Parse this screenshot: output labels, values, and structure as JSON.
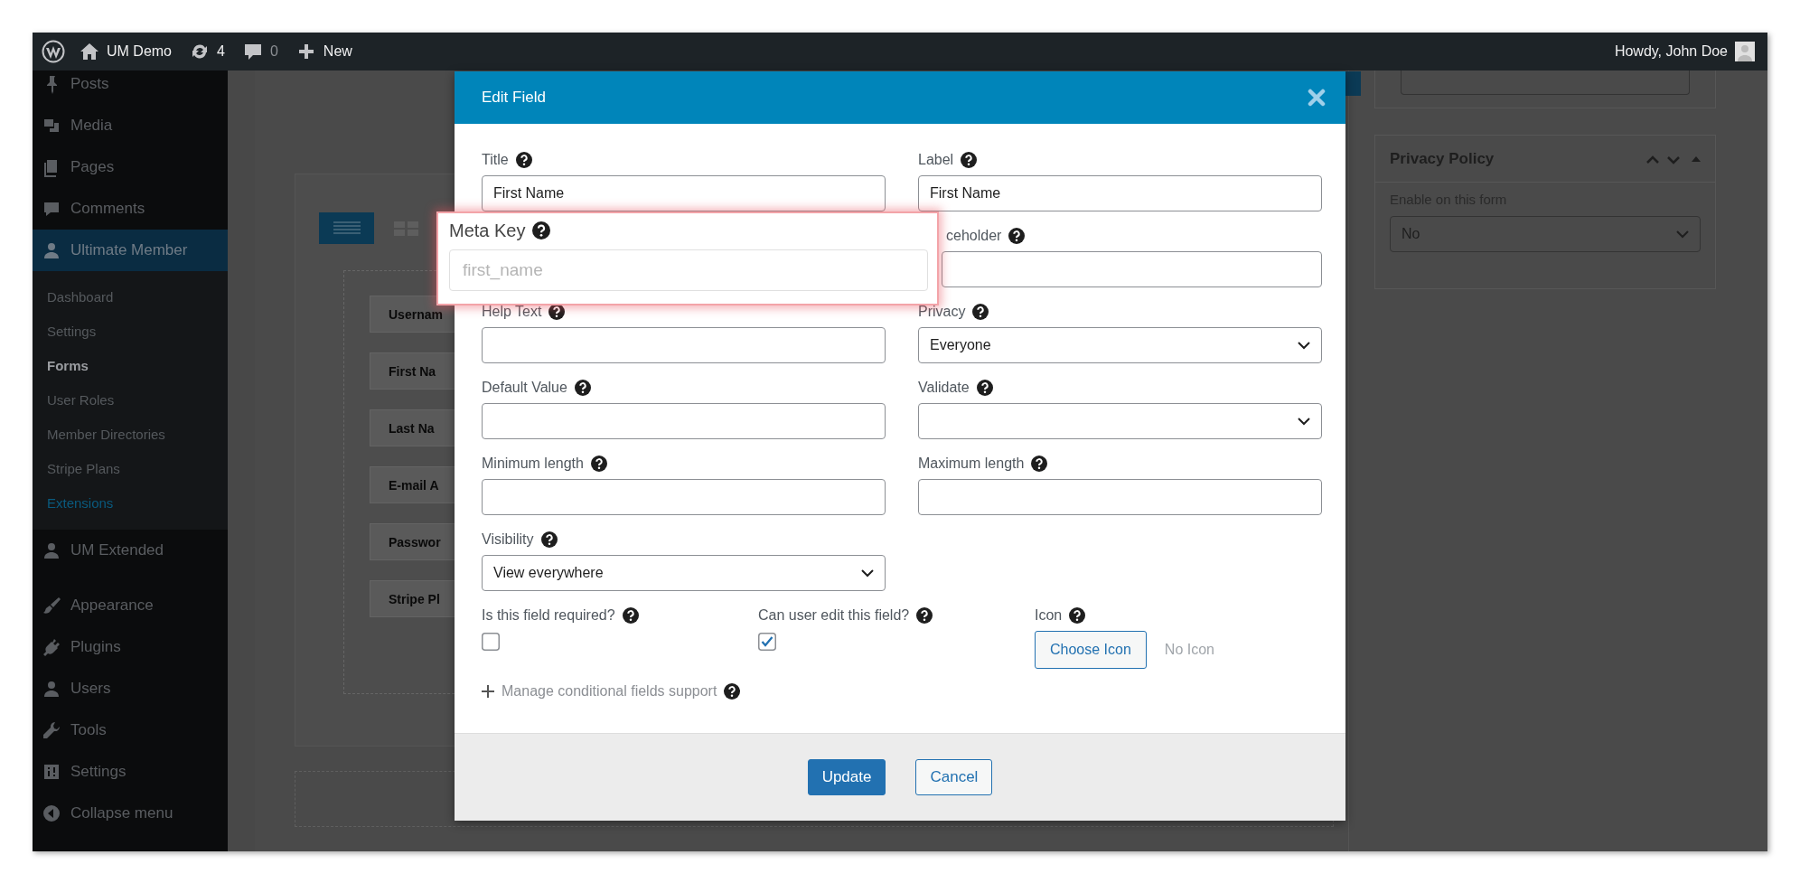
{
  "admin_bar": {
    "site_name": "UM Demo",
    "updates": "4",
    "comments": "0",
    "new_label": "New",
    "greeting": "Howdy, John Doe"
  },
  "sidebar": {
    "groups": [
      [
        {
          "label": "Posts",
          "selected": false
        },
        {
          "label": "Media",
          "selected": false
        },
        {
          "label": "Pages",
          "selected": false
        },
        {
          "label": "Comments",
          "selected": false
        },
        {
          "label": "Ultimate Member",
          "selected": true,
          "children": [
            {
              "label": "Dashboard",
              "selected": false,
              "kind": "link"
            },
            {
              "label": "Settings",
              "selected": false,
              "kind": "link"
            },
            {
              "label": "Forms",
              "selected": true,
              "kind": "link"
            },
            {
              "label": "User Roles",
              "selected": false,
              "kind": "link"
            },
            {
              "label": "Member Directories",
              "selected": false,
              "kind": "link"
            },
            {
              "label": "Stripe Plans",
              "selected": false,
              "kind": "link"
            },
            {
              "label": "Extensions",
              "selected": false,
              "kind": "highlight"
            }
          ]
        },
        {
          "label": "UM Extended",
          "selected": false
        }
      ],
      [
        {
          "label": "Appearance",
          "selected": false
        },
        {
          "label": "Plugins",
          "selected": false
        },
        {
          "label": "Users",
          "selected": false
        },
        {
          "label": "Tools",
          "selected": false
        },
        {
          "label": "Settings",
          "selected": false
        },
        {
          "label": "Collapse menu",
          "selected": false
        }
      ]
    ]
  },
  "builder": {
    "rows": [
      "Usernam",
      "First Na",
      "Last Na",
      "E-mail A",
      "Passwor",
      "Stripe Pl"
    ]
  },
  "side_panel": {
    "title": "Privacy Policy",
    "label": "Enable on this form",
    "value": "No"
  },
  "modal": {
    "title": "Edit Field",
    "fields": [
      {
        "label": "Title",
        "kind": "text",
        "value": "First Name"
      },
      {
        "label": "Label",
        "kind": "text",
        "value": "First Name"
      },
      {
        "label": "Meta Key",
        "kind": "callout",
        "placeholder": "first_name"
      },
      {
        "label": "ceholder",
        "kind": "text"
      },
      {
        "label": "Help Text",
        "kind": "text"
      },
      {
        "label": "Privacy",
        "kind": "select",
        "value": "Everyone"
      },
      {
        "label": "Default Value",
        "kind": "text"
      },
      {
        "label": "Validate",
        "kind": "select"
      },
      {
        "label": "Minimum length",
        "kind": "text"
      },
      {
        "label": "Maximum length",
        "kind": "text"
      },
      {
        "label": "Visibility",
        "kind": "select",
        "value": "View everywhere"
      }
    ],
    "options": [
      {
        "label": "Is this field required?",
        "checked": false
      },
      {
        "label": "Can user edit this field?",
        "checked": true
      }
    ],
    "icon_picker": {
      "label": "Icon",
      "button": "Choose Icon",
      "value": "No Icon"
    },
    "conditional_link": "Manage conditional fields support",
    "buttons": [
      {
        "label": "Update",
        "kind": "primary"
      },
      {
        "label": "Cancel",
        "kind": "secondary"
      }
    ]
  }
}
